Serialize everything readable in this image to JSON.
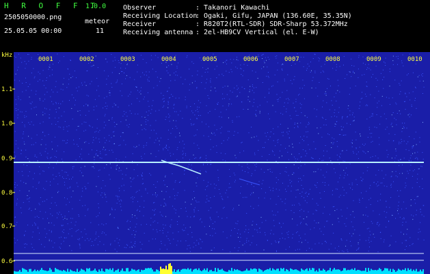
{
  "header": {
    "app_title": "H R O F F T",
    "app_version": "1.0.0",
    "file_name": "2505050000.png",
    "date_time": "25.05.05 00:00",
    "meteor_label": "meteor",
    "meteor_count": "11",
    "info": [
      {
        "label": "Observer",
        "value": ": Takanori Kawachi"
      },
      {
        "label": "Receiving Location",
        "value": ": Ogaki, Gifu, JAPAN (136.60E, 35.35N)"
      },
      {
        "label": "Receiver",
        "value": ": R820T2(RTL-SDR) SDR-Sharp 53.372MHz"
      },
      {
        "label": "Receiving antenna",
        "value": ": 2el-HB9CV Vertical (el. E-W)"
      }
    ]
  },
  "spectrogram": {
    "y_unit": "kHz",
    "y_ticks": [
      "1.1",
      "1.0",
      "0.9",
      "0.8",
      "0.7",
      "0.6"
    ],
    "x_ticks": [
      "0001",
      "0002",
      "0003",
      "0004",
      "0005",
      "0006",
      "0007",
      "0008",
      "0009",
      "0010"
    ],
    "colors": {
      "background": "#1a1ea8",
      "noise": "#3a55ff",
      "carrier": "#b8f0ff",
      "baseline": "#00e0ff",
      "burst": "#ffff30",
      "labels": "#ffff40"
    }
  }
}
